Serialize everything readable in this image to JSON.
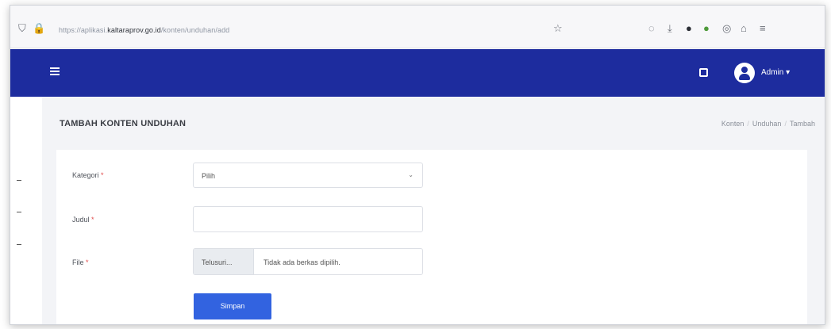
{
  "browser": {
    "url_prefix": "https://aplikasi.",
    "url_domain": "kaltaraprov.go.id",
    "url_path": "/konten/unduhan/add"
  },
  "topbar": {
    "user_name": "Admin",
    "user_caret": "▾"
  },
  "page": {
    "title": "TAMBAH KONTEN UNDUHAN",
    "breadcrumb": [
      "Konten",
      "Unduhan",
      "Tambah"
    ],
    "breadcrumb_sep": "/"
  },
  "form": {
    "kategori_label": "Kategori",
    "kategori_value": "Pilih",
    "judul_label": "Judul",
    "judul_value": "",
    "file_label": "File",
    "file_browse": "Telusuri...",
    "file_status": "Tidak ada berkas dipilih.",
    "required_mark": "*",
    "submit_label": "Simpan"
  },
  "colors": {
    "navbar": "#1d2c9e",
    "primary_button": "#3263e0",
    "required": "#e04a4a"
  },
  "icons": [
    "shield-icon",
    "lock-icon",
    "star-icon",
    "hamburger-icon",
    "fullscreen-icon",
    "avatar-icon",
    "chevron-down-icon"
  ]
}
